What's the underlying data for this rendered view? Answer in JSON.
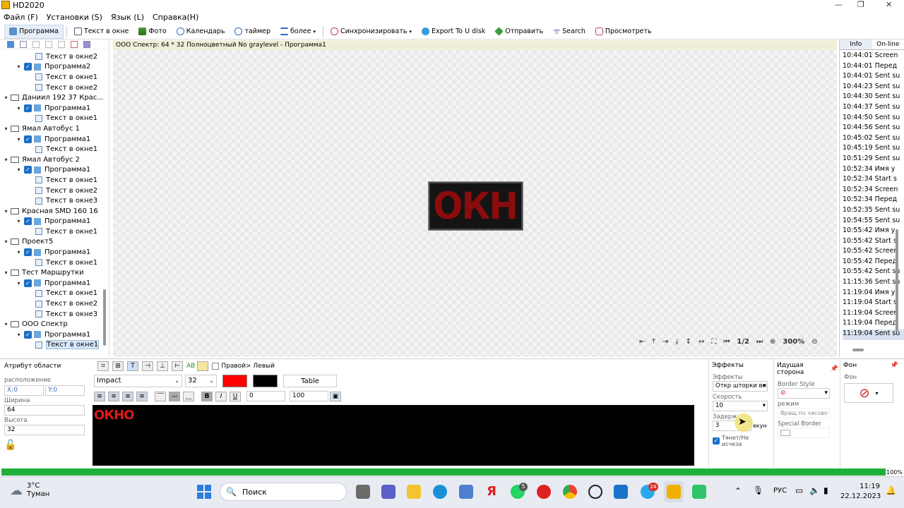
{
  "window": {
    "title": "HD2020"
  },
  "menu": [
    "Файл (F)",
    "Установки (S)",
    "Язык (L)",
    "Справка(H)"
  ],
  "toolbar": {
    "program": "Программа",
    "text_window": "Текст в окне",
    "photo": "Фото",
    "calendar": "Календарь",
    "timer": "таймер",
    "more": "более",
    "sync": "Синхронизировать",
    "export": "Export To U disk",
    "send": "Отправить",
    "search": "Search",
    "preview": "Просмотреть"
  },
  "tree": [
    {
      "level": 2,
      "type": "text",
      "label": "Текст в окне2"
    },
    {
      "level": 1,
      "type": "program",
      "label": "Программа2"
    },
    {
      "level": 2,
      "type": "text",
      "label": "Текст в окне1"
    },
    {
      "level": 2,
      "type": "text",
      "label": "Текст в окне2"
    },
    {
      "level": 0,
      "type": "screen",
      "label": "Даниил 192 37 Крас..."
    },
    {
      "level": 1,
      "type": "program",
      "label": "Программа1"
    },
    {
      "level": 2,
      "type": "text",
      "label": "Текст в окне1"
    },
    {
      "level": 0,
      "type": "screen",
      "label": "Ямал Автобус 1"
    },
    {
      "level": 1,
      "type": "program",
      "label": "Программа1"
    },
    {
      "level": 2,
      "type": "text",
      "label": "Текст в окне1"
    },
    {
      "level": 0,
      "type": "screen",
      "label": "Ямал Автобус 2"
    },
    {
      "level": 1,
      "type": "program",
      "label": "Программа1"
    },
    {
      "level": 2,
      "type": "text",
      "label": "Текст в окне1"
    },
    {
      "level": 2,
      "type": "text",
      "label": "Текст в окне2"
    },
    {
      "level": 2,
      "type": "text",
      "label": "Текст в окне3"
    },
    {
      "level": 0,
      "type": "screen",
      "label": "Красная SMD 160 16"
    },
    {
      "level": 1,
      "type": "program",
      "label": "Программа1"
    },
    {
      "level": 2,
      "type": "text",
      "label": "Текст в окне1"
    },
    {
      "level": 0,
      "type": "screen",
      "label": "Проект5"
    },
    {
      "level": 1,
      "type": "program",
      "label": "Программа1"
    },
    {
      "level": 2,
      "type": "text",
      "label": "Текст в окне1"
    },
    {
      "level": 0,
      "type": "screen",
      "label": "Тест Маршрутки"
    },
    {
      "level": 1,
      "type": "program",
      "label": "Программа1"
    },
    {
      "level": 2,
      "type": "text",
      "label": "Текст в окне1"
    },
    {
      "level": 2,
      "type": "text",
      "label": "Текст в окне2"
    },
    {
      "level": 2,
      "type": "text",
      "label": "Текст в окне3"
    },
    {
      "level": 0,
      "type": "screen",
      "label": "ООО Спектр"
    },
    {
      "level": 1,
      "type": "program",
      "label": "Программа1"
    },
    {
      "level": 2,
      "type": "text",
      "label": "Текст в окне1",
      "selected": true
    }
  ],
  "canvas": {
    "header": "ООО Спектр: 64 * 32 Полноцветный No graylevel - Программа1",
    "led_text": "ОКН",
    "page": "1/2",
    "zoom": "300%"
  },
  "right_panel": {
    "tab_info": "Info",
    "tab_online": "On-line",
    "log": [
      "10:44:01 Screen",
      "10:44:01 Перед",
      "10:44:01 Sent su",
      "10:44:23 Sent su",
      "10:44:30 Sent su",
      "10:44:37 Sent su",
      "10:44:50 Sent su",
      "10:44:56 Sent su",
      "10:45:02 Sent su",
      "10:45:19 Sent su",
      "10:51:29 Sent su",
      "10:52:34 Имя у",
      "10:52:34 Start s",
      "10:52:34 Screen",
      "10:52:34 Перед",
      "10:52:35 Sent su",
      "10:54:55 Sent su",
      "10:55:42 Имя у",
      "10:55:42 Start s",
      "10:55:42 Screen",
      "10:55:42 Перед",
      "10:55:42 Sent su",
      "11:15:36 Sent su",
      "11:19:04 Имя у",
      "11:19:04 Start s",
      "11:19:04 Screen",
      "11:19:04 Перед",
      "11:19:04 Sent su"
    ]
  },
  "attributes": {
    "header": "Атрибут области",
    "position_label": "расположение",
    "x": "X:0",
    "y": "Y:0",
    "width_label": "Ширина",
    "width": "64",
    "height_label": "Высота",
    "height": "32"
  },
  "format": {
    "direction": "Правой> Левый",
    "font": "Impact",
    "size": "32",
    "text_color": "#ff0000",
    "bg_color": "#000000",
    "table": "Table",
    "spacing": "0",
    "scale": "100"
  },
  "editor": {
    "text": "ОКНО"
  },
  "effects": {
    "header": "Эффекты",
    "effect_label": "Эффекты",
    "effect": "Откр шторки вн",
    "speed_label": "Скорость",
    "speed": "10",
    "delay_label": "Задерж",
    "delay": "3",
    "delay_unit": "екун",
    "drag": "Тянет/Не исчеза"
  },
  "border": {
    "header": "Идущая сторона",
    "style_label": "Border Style",
    "mode_label": "режим",
    "mode": "Вращ по часово",
    "special_label": "Special Border"
  },
  "background": {
    "header": "Фон",
    "label": "Фон"
  },
  "progress": {
    "value": 1.0,
    "text": "100%"
  },
  "taskbar": {
    "weather_temp": "3°C",
    "weather_desc": "Туман",
    "search": "Поиск",
    "lang": "РУС",
    "time": "11:19",
    "date": "22.12.2023",
    "whatsapp_badge": "5",
    "telegram_badge": "24"
  }
}
